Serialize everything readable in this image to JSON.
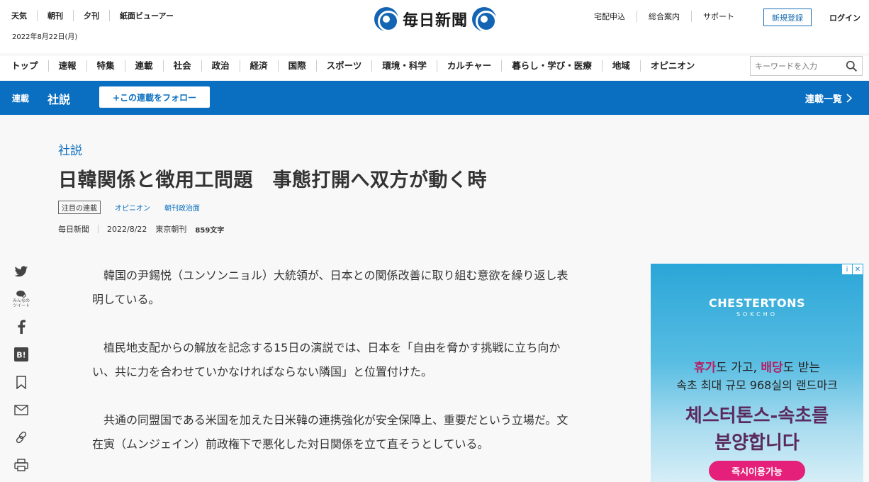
{
  "header": {
    "util_left": [
      "天気",
      "朝刊",
      "夕刊",
      "紙面ビューアー"
    ],
    "date": "2022年8月22日(月)",
    "logo": "毎日新聞",
    "util_right": [
      "宅配申込",
      "総合案内",
      "サポート"
    ],
    "register": "新規登録",
    "login": "ログイン"
  },
  "gnav": {
    "items": [
      "トップ",
      "速報",
      "特集",
      "連載",
      "社会",
      "政治",
      "経済",
      "国際",
      "スポーツ",
      "環境・科学",
      "カルチャー",
      "暮らし・学び・医療",
      "地域",
      "オピニオン"
    ],
    "search_placeholder": "キーワードを入力"
  },
  "series_bar": {
    "label": "連載",
    "title": "社説",
    "follow": "+この連載をフォロー",
    "list_link": "連載一覧"
  },
  "article": {
    "category": "社説",
    "headline": "日韓関係と徴用工問題　事態打開へ双方が動く時",
    "tag_box": "注目の連載",
    "tags": [
      "オピニオン",
      "朝刊政治面"
    ],
    "source": "毎日新聞",
    "date": "2022/8/22",
    "edition": "東京朝刊",
    "chars": "859文字",
    "paragraphs": [
      "韓国の尹錫悦（ユンソンニョル）大統領が、日本との関係改善に取り組む意欲を繰り返し表明している。",
      "植民地支配からの解放を記念する15日の演説では、日本を「自由を脅かす挑戦に立ち向かい、共に力を合わせていかなければならない隣国」と位置付けた。",
      "共通の同盟国である米国を加えた日米韓の連携強化が安全保障上、重要だという立場だ。文在寅（ムンジェイン）前政権下で悪化した対日関係を立て直そうとしている。"
    ]
  },
  "share": {
    "minna_label": "みんなのツイート"
  },
  "ad": {
    "badge_info": "i",
    "badge_close": "✕",
    "brand": "CHESTERTONS",
    "brand_sub": "SOKCHO",
    "copy1_pre": "휴가",
    "copy1_mid": "도 가고, ",
    "copy1_b2": "배당",
    "copy1_post": "도 받는",
    "copy2": "속초 최대 규모 968실의 랜드마크",
    "copy3_line1": "체스터톤스-속초를",
    "copy3_line2": "분양합니다",
    "cta": "즉시이용가능"
  },
  "colors": {
    "brand_blue": "#0a6fc1",
    "ad_pink": "#e5207a"
  }
}
